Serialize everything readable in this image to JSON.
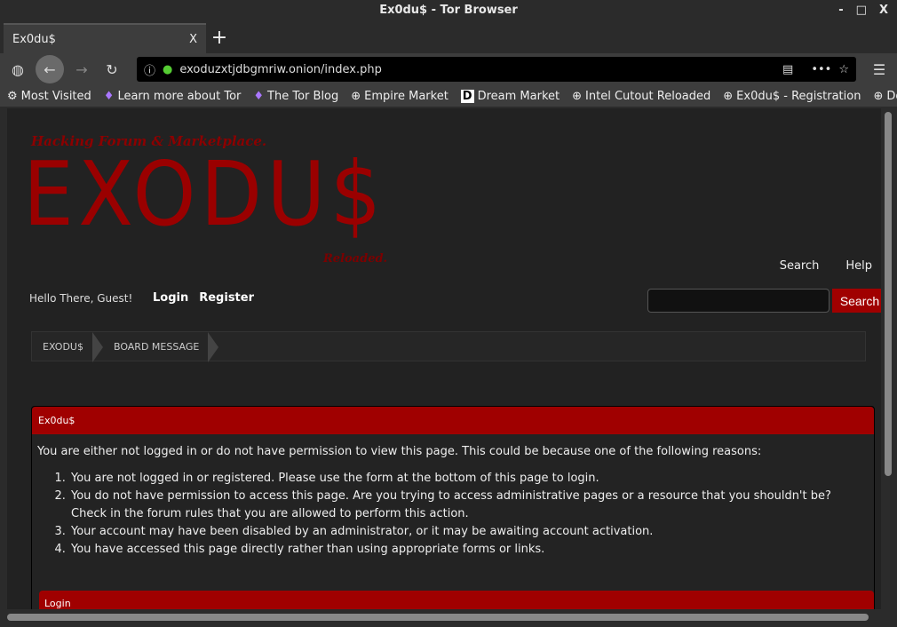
{
  "window": {
    "title": "Ex0du$ - Tor Browser",
    "controls": [
      "-",
      "□",
      "X"
    ]
  },
  "tab": {
    "title": "Ex0du$",
    "close": "X",
    "new_tab": "+"
  },
  "url": "exoduzxtjdbgmriw.onion/index.php",
  "bookmarks": [
    {
      "label": "Most Visited",
      "icon": "gear-icon"
    },
    {
      "label": "Learn more about Tor",
      "icon": "onion-icon"
    },
    {
      "label": "The Tor Blog",
      "icon": "onion-icon"
    },
    {
      "label": "Empire Market",
      "icon": "globe-icon"
    },
    {
      "label": "Dream Market",
      "icon": "dream-icon"
    },
    {
      "label": "Intel Cutout Reloaded",
      "icon": "globe-icon"
    },
    {
      "label": "Ex0du$ - Registration",
      "icon": "globe-icon"
    },
    {
      "label": "Doxbin",
      "icon": "globe-icon"
    }
  ],
  "header": {
    "tagline": "Hacking Forum & Marketplace.",
    "logo": "EXODU$",
    "sublogo": "Reloaded.",
    "links": [
      "Search",
      "Help"
    ],
    "welcome": "Hello There, Guest!",
    "login": "Login",
    "register": "Register",
    "search_button": "Search"
  },
  "breadcrumb": [
    "EXODU$",
    "BOARD MESSAGE"
  ],
  "panel": {
    "title": "Ex0du$",
    "intro": "You are either not logged in or do not have permission to view this page. This could be because one of the following reasons:",
    "reasons": [
      "You are not logged in or registered. Please use the form at the bottom of this page to login.",
      "You do not have permission to access this page. Are you trying to access administrative pages or a resource that you shouldn't be? Check in the forum rules that you are allowed to perform this action.",
      "Your account may have been disabled by an administrator, or it may be awaiting account activation.",
      "You have accessed this page directly rather than using appropriate forms or links."
    ],
    "login_title": "Login"
  },
  "colors": {
    "accent": "#a00000",
    "background": "#222222"
  }
}
